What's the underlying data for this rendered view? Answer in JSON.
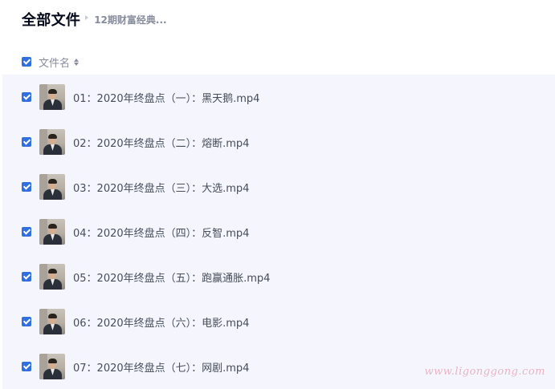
{
  "breadcrumb": {
    "root": "全部文件",
    "current": "12期财富经典..."
  },
  "header": {
    "select_all_checked": true,
    "column_title": "文件名"
  },
  "files": [
    {
      "name": "01：2020年终盘点（一）：黑天鹅.mp4",
      "checked": true,
      "thumbnail": "video-thumbnail-man-in-suit"
    },
    {
      "name": "02：2020年终盘点（二）：熔断.mp4",
      "checked": true,
      "thumbnail": "video-thumbnail-man-in-suit"
    },
    {
      "name": "03：2020年终盘点（三）：大选.mp4",
      "checked": true,
      "thumbnail": "video-thumbnail-man-in-suit"
    },
    {
      "name": "04：2020年终盘点（四）：反智.mp4",
      "checked": true,
      "thumbnail": "video-thumbnail-man-in-suit"
    },
    {
      "name": "05：2020年终盘点（五）：跑赢通胀.mp4",
      "checked": true,
      "thumbnail": "video-thumbnail-man-in-suit"
    },
    {
      "name": "06：2020年终盘点（六）：电影.mp4",
      "checked": true,
      "thumbnail": "video-thumbnail-man-in-suit"
    },
    {
      "name": "07：2020年终盘点（七）：网剧.mp4",
      "checked": true,
      "thumbnail": "video-thumbnail-man-in-suit"
    }
  ],
  "watermark": "www.ligonggong.com",
  "colors": {
    "accent": "#2f6fe0",
    "list_background": "#f5f6fd",
    "text_primary": "#03081a",
    "text_secondary": "#878c9c"
  }
}
